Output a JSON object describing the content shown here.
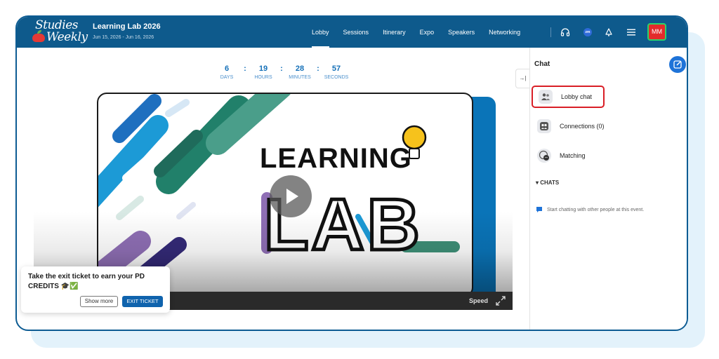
{
  "brand": {
    "line1": "Studies",
    "line2": "Weekly"
  },
  "event": {
    "title": "Learning Lab 2026",
    "dates": "Jun 15, 2026 - Jun 16, 2026"
  },
  "nav": [
    {
      "label": "Lobby",
      "active": true
    },
    {
      "label": "Sessions"
    },
    {
      "label": "Itinerary"
    },
    {
      "label": "Expo"
    },
    {
      "label": "Speakers"
    },
    {
      "label": "Networking"
    }
  ],
  "header_icons": [
    "headset-icon",
    "zoom-badge-icon",
    "bell-icon",
    "menu-icon"
  ],
  "zoom_badge": "zm",
  "user": {
    "initials": "MM"
  },
  "countdown": [
    {
      "value": "6",
      "label": "DAYS"
    },
    {
      "value": "19",
      "label": "HOURS"
    },
    {
      "value": "28",
      "label": "MINUTES"
    },
    {
      "value": "57",
      "label": "SECONDS"
    }
  ],
  "video": {
    "art_line1": "LEARNING",
    "art_line2": "LAB",
    "speed_label": "Speed"
  },
  "exit_ticket": {
    "message": "Take the exit ticket to earn your PD CREDITS 🎓✅",
    "show_more": "Show more",
    "action": "EXIT TICKET"
  },
  "chat": {
    "title": "Chat",
    "collapse_glyph": "→|",
    "items": [
      {
        "label": "Lobby chat",
        "icon": "people-icon"
      },
      {
        "label": "Connections (0)",
        "icon": "contacts-icon"
      },
      {
        "label": "Matching",
        "icon": "matching-icon"
      }
    ],
    "section": "▾ CHATS",
    "empty_text": "Start chatting with other people at this event."
  },
  "colors": {
    "header": "#0e5a8c",
    "accent": "#1570b8",
    "highlight": "#d91e26",
    "avatar": "#e32b2b"
  }
}
